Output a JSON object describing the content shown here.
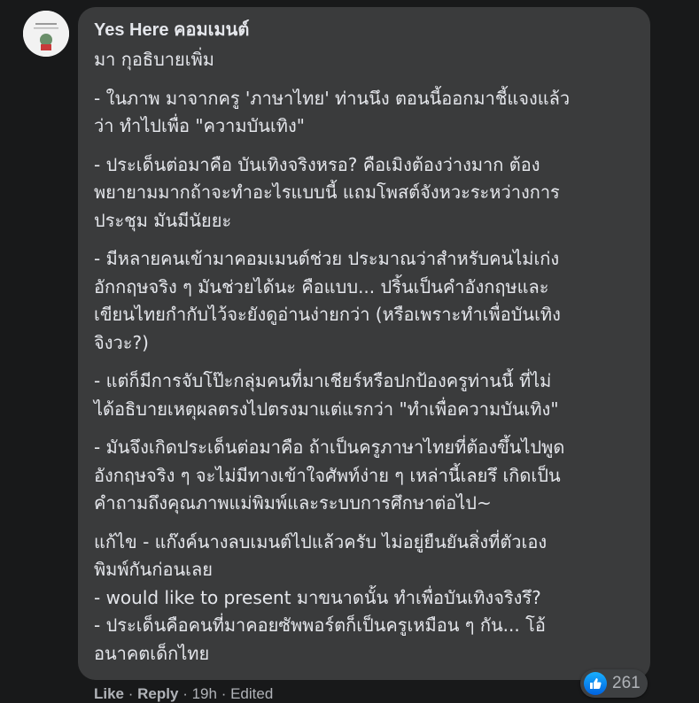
{
  "comment": {
    "author": "Yes Here คอมเมนต์",
    "paragraphs": [
      [
        "มา กุอธิบายเพิ่ม"
      ],
      [
        "- ในภาพ มาจากครู 'ภาษาไทย' ท่านนึง ตอนนี้ออกมาชี้แจงแล้ว",
        "ว่า ทำไปเพื่อ \"ความบันเทิง\""
      ],
      [
        "- ประเด็นต่อมาคือ บันเทิงจริงหรอ? คือเมิงต้องว่างมาก ต้อง",
        "พยายามมากถ้าจะทำอะไรแบบนี้ แถมโพสต์จังหวะระหว่างการ",
        "ประชุม มันมีนัยยะ"
      ],
      [
        "- มีหลายคนเข้ามาคอมเมนต์ช่วย ประมาณว่าสำหรับคนไม่เก่ง",
        "อักกฤษจริง ๆ มันช่วยได้นะ คือแบบ... ปริ้นเป็นคำอังกฤษและ",
        "เขียนไทยกำกับไว้จะยังดูอ่านง่ายกว่า (หรือเพราะทำเพื่อบันเทิง",
        "จิงวะ?)"
      ],
      [
        "- แต่ก็มีการจับโป๊ะกลุ่มคนที่มาเชียร์หรือปกป้องครูท่านนี้ ที่ไม่",
        "ได้อธิบายเหตุผลตรงไปตรงมาแต่แรกว่า \"ทำเพื่อความบันเทิง\""
      ],
      [
        "- มันจึงเกิดประเด็นต่อมาคือ ถ้าเป็นครูภาษาไทยที่ต้องขึ้นไปพูด",
        "อังกฤษจริง ๆ จะไม่มีทางเข้าใจศัพท์ง่าย ๆ เหล่านี้เลยรึ เกิดเป็น",
        "คำถามถึงคุณภาพแม่พิมพ์และระบบการศึกษาต่อไป~"
      ],
      [
        "แก้ไข - แก๊งค์นางลบเมนต์ไปแล้วครับ ไม่อยู่ยืนยันสิ่งที่ตัวเอง",
        "พิมพ์กันก่อนเลย",
        "- would like to present มาขนาดนั้น ทำเพื่อบันเทิงจริงรึ?",
        "- ประเด็นคือคนที่มาคอยซัพพอร์ตก็เป็นครูเหมือน ๆ กัน... โอ้",
        "อนาคตเด็กไทย"
      ]
    ]
  },
  "reactions": {
    "icon": "like-icon",
    "count": "261",
    "color": "#1877f2"
  },
  "actions": {
    "like": "Like",
    "reply": "Reply",
    "time": "19h",
    "edited": "Edited",
    "separator": "·"
  }
}
